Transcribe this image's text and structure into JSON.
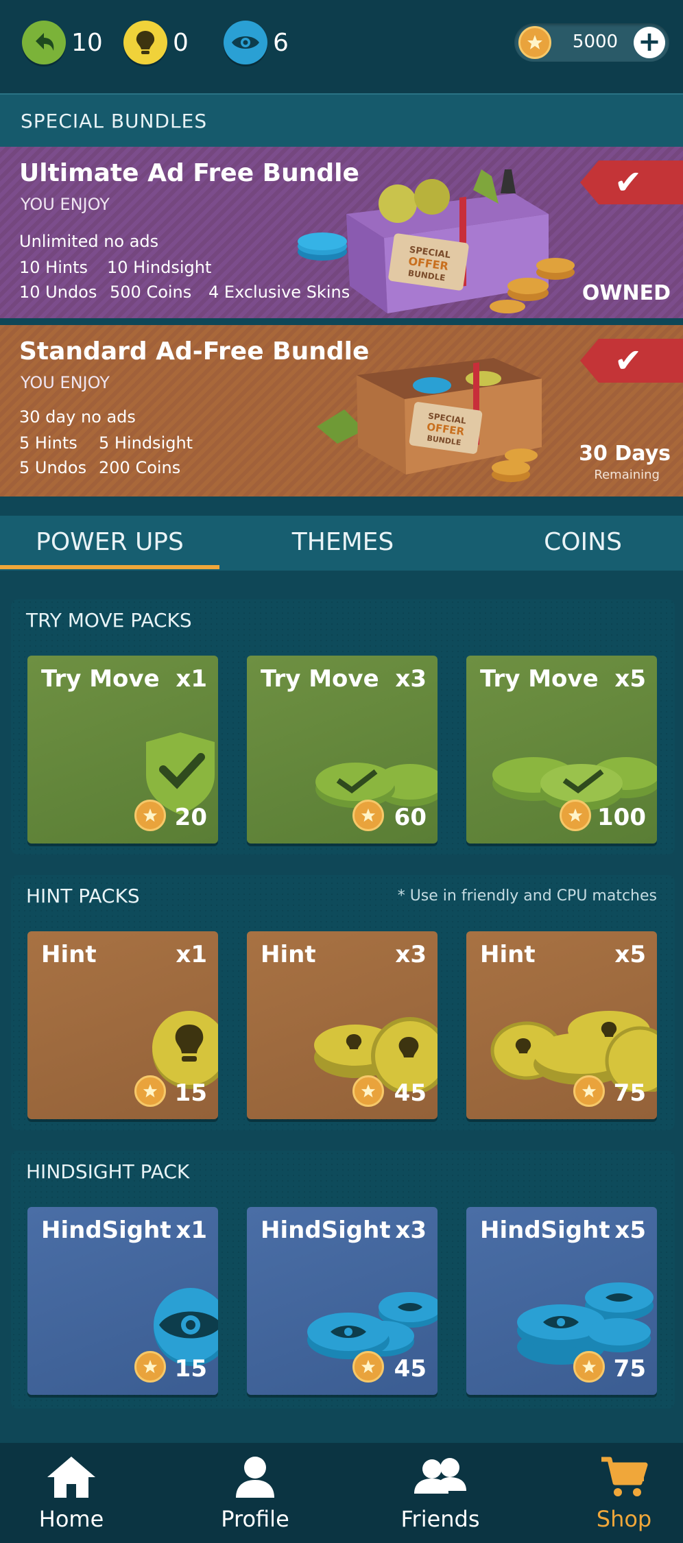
{
  "stats": {
    "undo": {
      "icon": "undo-icon",
      "value": "10",
      "color": "#7bb339"
    },
    "hint": {
      "icon": "lightbulb-icon",
      "value": "0",
      "color": "#f0d23a"
    },
    "hindsight": {
      "icon": "eye-icon",
      "value": "6",
      "color": "#2aa0d4"
    }
  },
  "coins": {
    "amount": "5000",
    "add_label": "+"
  },
  "special_bundles": {
    "header": "SPECIAL BUNDLES",
    "ultimate": {
      "title": "Ultimate Ad Free Bundle",
      "subtitle": "YOU ENJOY",
      "line1": "Unlimited no ads",
      "line2a": "10 Hints",
      "line2b": "10 Hindsight",
      "line3a": "10 Undos",
      "line3b": "500 Coins",
      "line3c": "4 Exclusive Skins",
      "status": "OWNED",
      "box_label": "SPECIAL OFFER BUNDLE",
      "color": "#7c4d8c"
    },
    "standard": {
      "title": "Standard Ad-Free Bundle",
      "subtitle": "YOU ENJOY",
      "line1": "30 day no ads",
      "line2a": "5 Hints",
      "line2b": "5 Hindsight",
      "line3a": "5 Undos",
      "line3b": "200 Coins",
      "days": "30 Days",
      "remaining": "Remaining",
      "box_label": "SPECIAL OFFER BUNDLE",
      "color": "#a9683a"
    }
  },
  "tabs": [
    {
      "label": "POWER UPS",
      "active": true
    },
    {
      "label": "THEMES",
      "active": false
    },
    {
      "label": "COINS",
      "active": false
    }
  ],
  "sections": {
    "try_move": {
      "title": "TRY MOVE PACKS",
      "cards": [
        {
          "name": "Try Move",
          "qty": "x1",
          "price": "20"
        },
        {
          "name": "Try Move",
          "qty": "x3",
          "price": "60"
        },
        {
          "name": "Try Move",
          "qty": "x5",
          "price": "100"
        }
      ]
    },
    "hint": {
      "title": "HINT PACKS",
      "note": "* Use in friendly and CPU matches",
      "cards": [
        {
          "name": "Hint",
          "qty": "x1",
          "price": "15"
        },
        {
          "name": "Hint",
          "qty": "x3",
          "price": "45"
        },
        {
          "name": "Hint",
          "qty": "x5",
          "price": "75"
        }
      ]
    },
    "hindsight": {
      "title": "HINDSIGHT PACK",
      "cards": [
        {
          "name": "HindSight",
          "qty": "x1",
          "price": "15"
        },
        {
          "name": "HindSight",
          "qty": "x3",
          "price": "45"
        },
        {
          "name": "HindSight",
          "qty": "x5",
          "price": "75"
        }
      ]
    }
  },
  "nav": [
    {
      "label": "Home",
      "icon": "home-icon",
      "active": false
    },
    {
      "label": "Profile",
      "icon": "person-icon",
      "active": false
    },
    {
      "label": "Friends",
      "icon": "friends-icon",
      "active": false
    },
    {
      "label": "Shop",
      "icon": "cart-icon",
      "active": true
    }
  ],
  "colors": {
    "accent": "#f0a73a",
    "background": "#0f4757"
  }
}
